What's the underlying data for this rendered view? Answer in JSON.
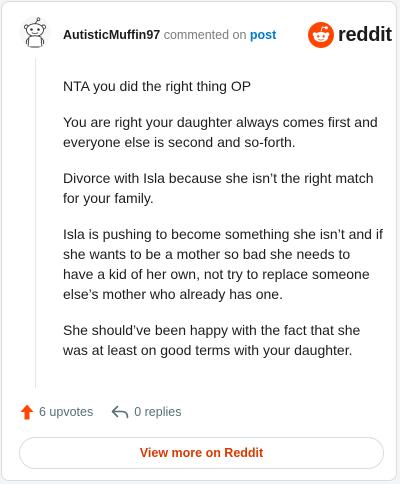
{
  "header": {
    "username": "AutisticMuffin97",
    "commented_text": "commented on",
    "post_link": "post",
    "brand": "reddit"
  },
  "comment": {
    "paragraphs": [
      "NTA you did the right thing OP",
      "You are right your daughter always comes first and everyone else is second and so-forth.",
      "Divorce with Isla because she isn’t the right match for your family.",
      "Isla is pushing to become something she isn’t and if she wants to be a mother so bad she needs to have a kid of her own, not try to replace someone else’s mother who already has one.",
      "She should’ve been happy with the fact that she was at least on good terms with your daughter."
    ]
  },
  "actions": {
    "upvotes": "6 upvotes",
    "replies": "0 replies"
  },
  "footer": {
    "view_more": "View more on Reddit"
  },
  "colors": {
    "brand_orange": "#ff4500",
    "link_blue": "#0079d3",
    "view_more_text": "#d93a00"
  },
  "icons": {
    "avatar": "snoo-avatar-icon",
    "logo": "reddit-snoo-icon",
    "upvote": "upvote-arrow-icon",
    "reply": "reply-arrow-icon"
  }
}
